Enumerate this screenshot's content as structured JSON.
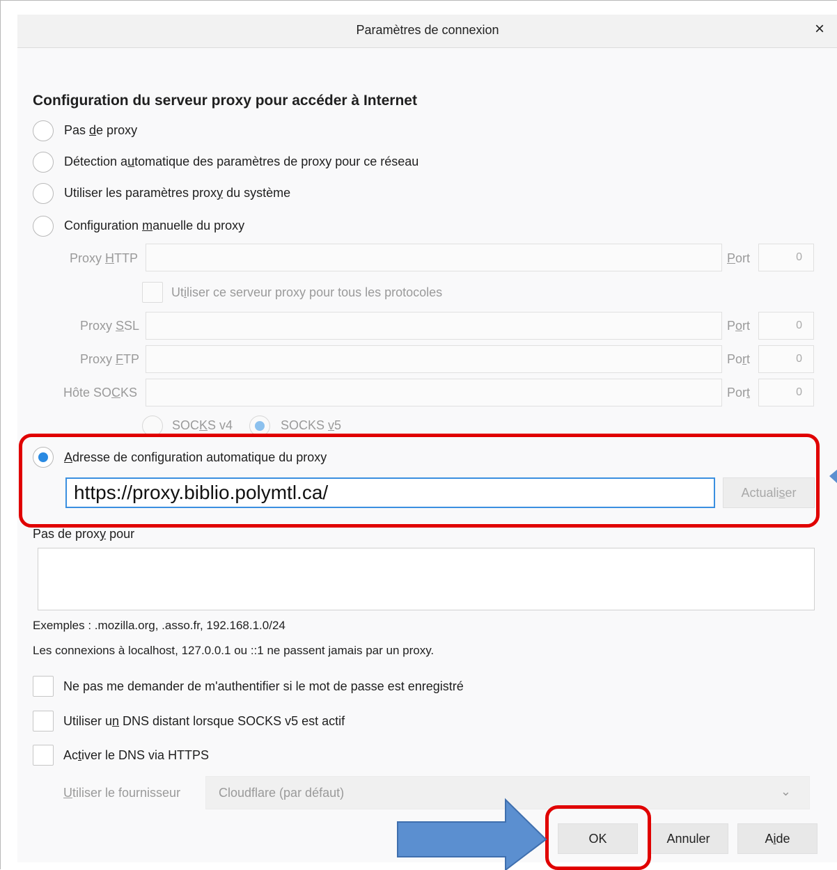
{
  "window": {
    "title": "Paramètres de connexion",
    "close_glyph": "×"
  },
  "heading": "Configuration du serveur proxy pour accéder à Internet",
  "proxy_options": [
    {
      "pre": "Pas ",
      "u": "d",
      "post": "e proxy",
      "checked": false
    },
    {
      "pre": "Détection a",
      "u": "u",
      "post": "tomatique des paramètres de proxy pour ce réseau",
      "checked": false
    },
    {
      "pre": "Utiliser les paramètres prox",
      "u": "y",
      "post": " du système",
      "checked": false
    },
    {
      "pre": "Configuration ",
      "u": "m",
      "post": "anuelle du proxy",
      "checked": false
    }
  ],
  "manual": {
    "http": {
      "pre": "Proxy ",
      "u": "H",
      "post": "TTP",
      "port_pre": "",
      "port_u": "P",
      "port_post": "ort",
      "port_value": "0"
    },
    "all_protocols": {
      "pre": "Ut",
      "u": "i",
      "post": "liser ce serveur proxy pour tous les protocoles"
    },
    "ssl": {
      "pre": "Proxy ",
      "u": "S",
      "post": "SL",
      "port_pre": "P",
      "port_u": "o",
      "port_post": "rt",
      "port_value": "0"
    },
    "ftp": {
      "pre": "Proxy ",
      "u": "F",
      "post": "TP",
      "port_pre": "Po",
      "port_u": "r",
      "port_post": "t",
      "port_value": "0"
    },
    "socks": {
      "pre": "Hôte SO",
      "u": "C",
      "post": "KS",
      "port_pre": "Por",
      "port_u": "t",
      "port_post": "",
      "port_value": "0"
    },
    "socks_v4": {
      "pre": "SOC",
      "u": "K",
      "post": "S v4"
    },
    "socks_v5": {
      "pre": "SOCKS ",
      "u": "v",
      "post": "5"
    }
  },
  "auto_config": {
    "pre": "",
    "u": "A",
    "post": "dresse de configuration automatique du proxy",
    "url": "https://proxy.biblio.polymtl.ca/",
    "reload_pre": "Actuali",
    "reload_u": "s",
    "reload_post": "er"
  },
  "no_proxy": {
    "pre": "Pas de prox",
    "u": "y",
    "post": " pour"
  },
  "examples": "Exemples : .mozilla.org, .asso.fr, 192.168.1.0/24",
  "localhost_note": "Les connexions à localhost, 127.0.0.1 ou ::1 ne passent jamais par un proxy.",
  "checkboxes": [
    {
      "pre": "Ne pas me demander de m'authentifier si le mot de passe est enre",
      "u": "g",
      "post": "istré"
    },
    {
      "pre": "Utiliser u",
      "u": "n",
      "post": " DNS distant lorsque SOCKS v5 est actif"
    },
    {
      "pre": "Ac",
      "u": "t",
      "post": "iver le DNS via HTTPS"
    }
  ],
  "provider": {
    "pre": "",
    "u": "U",
    "post": "tiliser le fournisseur",
    "value": "Cloudflare (par défaut)"
  },
  "buttons": {
    "ok": "OK",
    "cancel": "Annuler",
    "help_pre": "A",
    "help_u": "i",
    "help_post": "de"
  },
  "annotation_colors": {
    "highlight": "#e00000",
    "arrow": "#5b8fd0"
  }
}
